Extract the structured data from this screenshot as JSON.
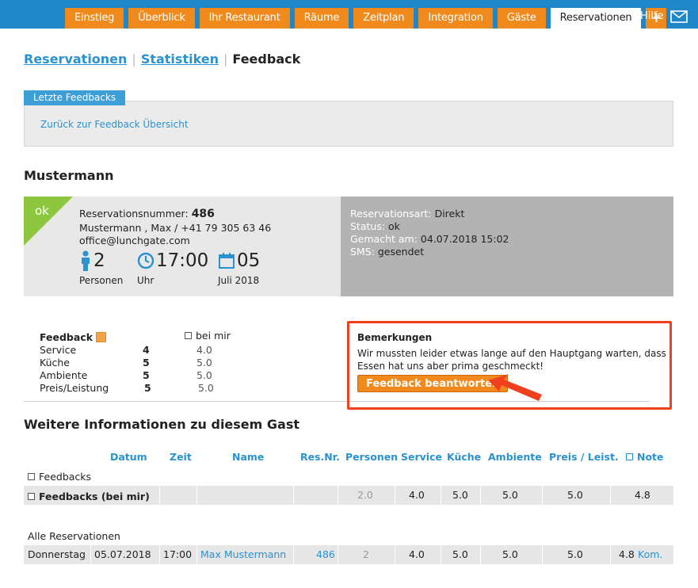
{
  "nav": {
    "tabs": [
      "Einstieg",
      "Überblick",
      "Ihr Restaurant",
      "Räume",
      "Zeitplan",
      "Integration",
      "Gäste",
      "Reservationen"
    ],
    "active": "Reservationen",
    "plus": "+",
    "hilfe": "Hilfe",
    "mail_icon": "mail-icon"
  },
  "subnav": {
    "reservationen": "Reservationen",
    "statistiken": "Statistiken",
    "feedback": "Feedback",
    "sep": "|"
  },
  "panel": {
    "tab_label": "Letzte Feedbacks",
    "back_link": "Zurück zur Feedback Übersicht"
  },
  "guest": {
    "name": "Mustermann"
  },
  "reservation": {
    "badge": "ok",
    "number_label": "Reservationsnummer:",
    "number": "486",
    "contact_line": "Mustermann , Max / +41 79 305 63 46",
    "email": "office@lunchgate.com",
    "persons": "2",
    "persons_label": "Personen",
    "time": "17:00",
    "time_label": "Uhr",
    "day": "05",
    "month_label": "Juli 2018",
    "art_label": "Reservationsart:",
    "art": "Direkt",
    "status_label": "Status:",
    "status": "ok",
    "gemacht_label": "Gemacht am:",
    "gemacht": "04.07.2018 15:02",
    "sms_label": "SMS:",
    "sms": "gesendet",
    "colors": {
      "badge": "#8dc63f",
      "right_panel": "#b3b3b3"
    }
  },
  "feedback": {
    "title": "Feedback",
    "bei_mir": "bei mir",
    "rows": [
      {
        "label": "Service",
        "score": "4",
        "avg": "4.0"
      },
      {
        "label": "Küche",
        "score": "5",
        "avg": "5.0"
      },
      {
        "label": "Ambiente",
        "score": "5",
        "avg": "5.0"
      },
      {
        "label": "Preis/Leistung",
        "score": "5",
        "avg": "5.0"
      }
    ]
  },
  "bemerkungen": {
    "title": "Bemerkungen",
    "text": "Wir mussten leider etwas lange auf den Hauptgang warten, dass Essen hat uns aber prima geschmeckt!",
    "button": "Feedback beantworten",
    "highlight_color": "#f0401e"
  },
  "weitere": {
    "title": "Weitere Informationen zu diesem Gast",
    "headers": [
      "Datum",
      "Zeit",
      "Name",
      "Res.Nr.",
      "Personen",
      "Service",
      "Küche",
      "Ambiente",
      "Preis / Leist.",
      "Note"
    ],
    "feedbacks_label": "Feedbacks",
    "feedbacks_bei_mir": {
      "label": "Feedbacks (bei mir)",
      "personen": "2.0",
      "service": "4.0",
      "kueche": "5.0",
      "ambiente": "5.0",
      "preis": "5.0",
      "note": "4.8"
    },
    "alle_label": "Alle Reservationen",
    "reservation_row": {
      "tag": "Donnerstag",
      "datum": "05.07.2018",
      "zeit": "17:00",
      "name": "Max Mustermann",
      "resnr": "486",
      "personen": "2",
      "service": "4.0",
      "kueche": "5.0",
      "ambiente": "5.0",
      "preis": "5.0",
      "note": "4.8",
      "kom": "Kom."
    }
  }
}
